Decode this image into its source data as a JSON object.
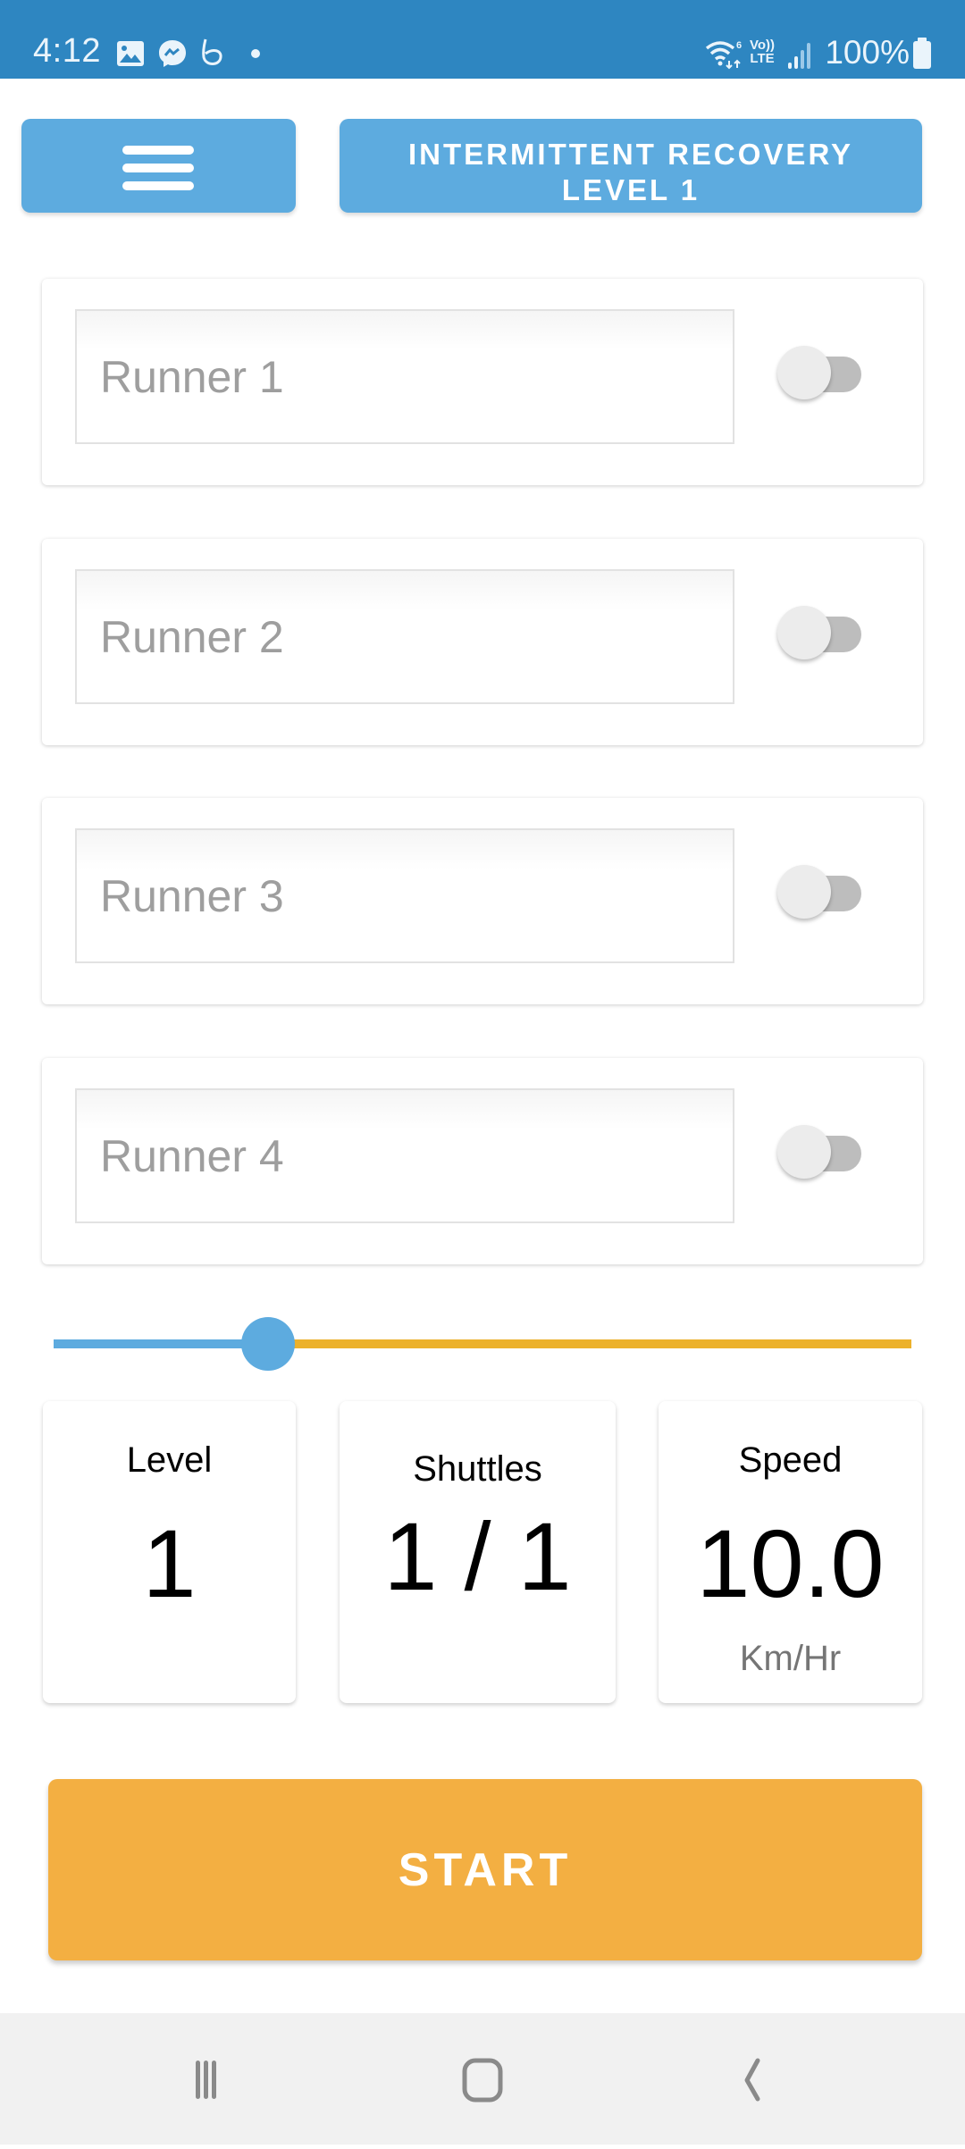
{
  "status_bar": {
    "time": "4:12",
    "notification_icons": [
      "gallery-icon",
      "messenger-icon",
      "beats-icon",
      "dot-icon"
    ],
    "system_icons": [
      "wifi-6-icon",
      "volte-icon",
      "signal-icon",
      "battery-icon"
    ],
    "volte_label_top": "Vo))",
    "volte_label_bottom": "LTE",
    "battery": "100%"
  },
  "header": {
    "menu_icon": "hamburger-menu-icon",
    "title_line1": "INTERMITTENT RECOVERY",
    "title_line2": "LEVEL 1"
  },
  "runners": [
    {
      "placeholder": "Runner 1",
      "value": "",
      "enabled": false
    },
    {
      "placeholder": "Runner 2",
      "value": "",
      "enabled": false
    },
    {
      "placeholder": "Runner 3",
      "value": "",
      "enabled": false
    },
    {
      "placeholder": "Runner 4",
      "value": "",
      "enabled": false
    }
  ],
  "slider": {
    "value_fraction": 0.25,
    "active_color": "#5dabdf",
    "inactive_color": "#ecb12b"
  },
  "stats": {
    "level": {
      "label": "Level",
      "value": "1"
    },
    "shuttles": {
      "label": "Shuttles",
      "value": "1 / 1"
    },
    "speed": {
      "label": "Speed",
      "value": "10.0",
      "unit": "Km/Hr"
    }
  },
  "start_button": {
    "label": "START",
    "color": "#f3af42"
  },
  "colors": {
    "primary": "#5dabdf",
    "status_bar": "#2e86c1"
  },
  "nav_bar": {
    "icons": [
      "recent-apps-icon",
      "home-icon",
      "back-icon"
    ]
  }
}
